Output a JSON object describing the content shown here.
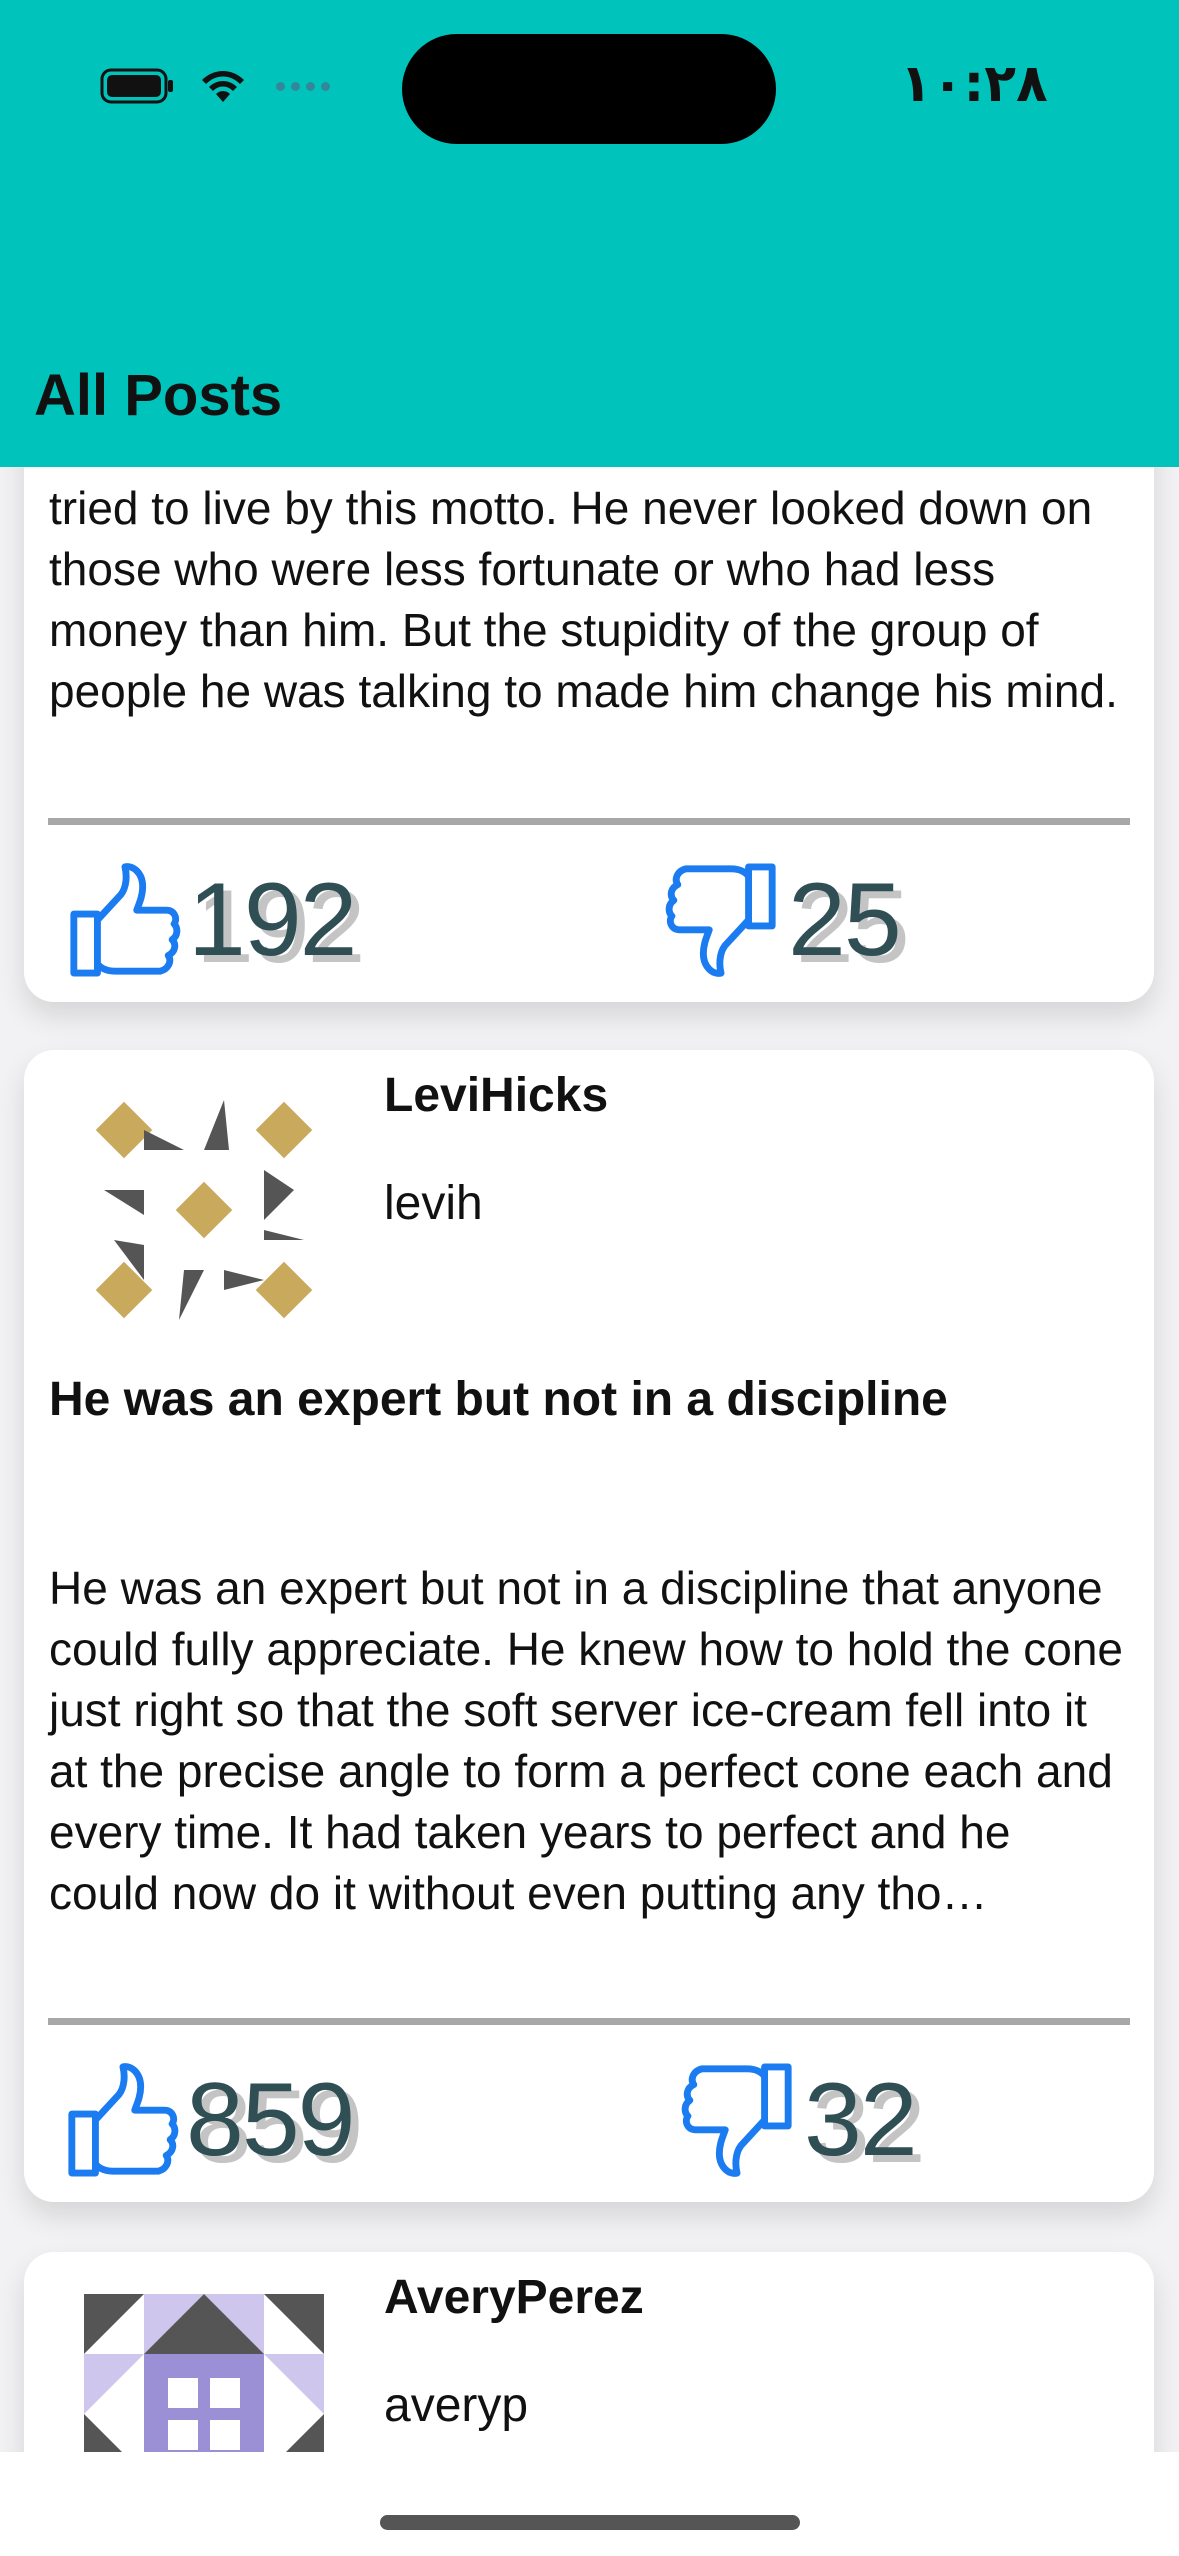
{
  "status_bar": {
    "time": "١٠:٢٨"
  },
  "header": {
    "title": "All Posts"
  },
  "posts": [
    {
      "body": "tried to live by this motto. He never looked down on those who were less fortunate or who had less money than him. But the stupidity of the group of people he was talking to made him change his mind.",
      "likes": "192",
      "dislikes": "25"
    },
    {
      "display_name": "LeviHicks",
      "username": "levih",
      "title": "He was an expert but not in a discipline",
      "body": "He was an expert but not in a discipline that anyone could fully appreciate. He knew how to hold the cone just right so that the soft server ice-cream fell into it at the precise angle to form a perfect cone each and every time. It had taken years to perfect and he could now do it without even putting any tho…",
      "likes": "859",
      "dislikes": "32"
    },
    {
      "display_name": "AveryPerez",
      "username": "averyp"
    }
  ],
  "colors": {
    "header_bg": "#00c4bb",
    "icon_blue": "#1a7cf0",
    "count_text": "#2f4f55",
    "avatar_gold": "#c9a95c",
    "avatar_gray": "#555555",
    "avatar_purple": "#9b8fd6"
  },
  "icons": {
    "like": "thumbs-up-icon",
    "dislike": "thumbs-down-icon"
  }
}
